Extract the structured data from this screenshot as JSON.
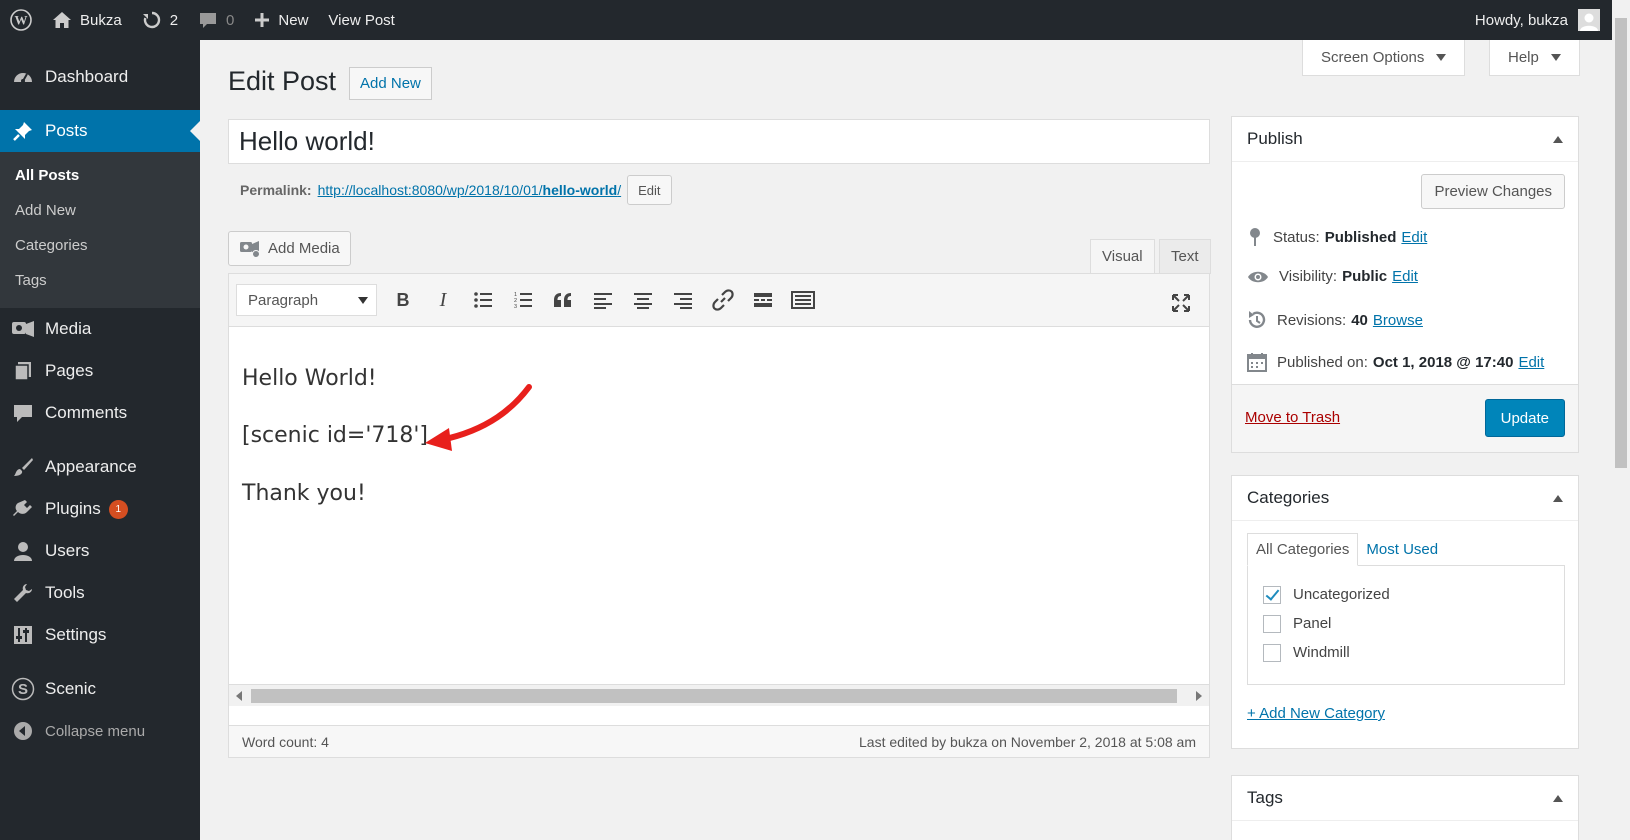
{
  "adminbar": {
    "site_name": "Bukza",
    "updates_count": "2",
    "comments_count": "0",
    "new_label": "New",
    "view_post_label": "View Post",
    "howdy": "Howdy, bukza"
  },
  "sidebar": {
    "dashboard": "Dashboard",
    "posts": "Posts",
    "posts_sub": [
      "All Posts",
      "Add New",
      "Categories",
      "Tags"
    ],
    "media": "Media",
    "pages": "Pages",
    "comments": "Comments",
    "appearance": "Appearance",
    "plugins": "Plugins",
    "plugins_badge": "1",
    "users": "Users",
    "tools": "Tools",
    "settings": "Settings",
    "scenic": "Scenic",
    "collapse": "Collapse menu"
  },
  "top_tabs": {
    "screen_options": "Screen Options",
    "help": "Help"
  },
  "header": {
    "title": "Edit Post",
    "add_new": "Add New"
  },
  "post": {
    "title": "Hello world!",
    "permalink_label": "Permalink:",
    "permalink_base": "http://localhost:8080/wp/2018/10/01/",
    "permalink_slug": "hello-world",
    "permalink_end": "/",
    "permalink_edit": "Edit"
  },
  "editor": {
    "add_media": "Add Media",
    "tab_visual": "Visual",
    "tab_text": "Text",
    "format": "Paragraph",
    "paragraphs": [
      "Hello World!",
      "[scenic id='718']",
      "Thank you!"
    ],
    "word_count": "Word count: 4",
    "last_edited": "Last edited by bukza on November 2, 2018 at 5:08 am"
  },
  "publish": {
    "title": "Publish",
    "preview": "Preview Changes",
    "status_label": "Status:",
    "status_value": "Published",
    "visibility_label": "Visibility:",
    "visibility_value": "Public",
    "revisions_label": "Revisions:",
    "revisions_value": "40",
    "browse": "Browse",
    "published_label": "Published on:",
    "published_value": "Oct 1, 2018 @ 17:40",
    "edit": "Edit",
    "trash": "Move to Trash",
    "update": "Update"
  },
  "categories": {
    "title": "Categories",
    "tab_all": "All Categories",
    "tab_used": "Most Used",
    "items": [
      {
        "label": "Uncategorized",
        "checked": true
      },
      {
        "label": "Panel",
        "checked": false
      },
      {
        "label": "Windmill",
        "checked": false
      }
    ],
    "add_new": "+ Add New Category"
  },
  "tags": {
    "title": "Tags"
  },
  "colors": {
    "admin_dark": "#23282d",
    "accent": "#0073aa",
    "button_primary": "#0085ba",
    "trash": "#a00",
    "arrow": "#e8201c"
  }
}
